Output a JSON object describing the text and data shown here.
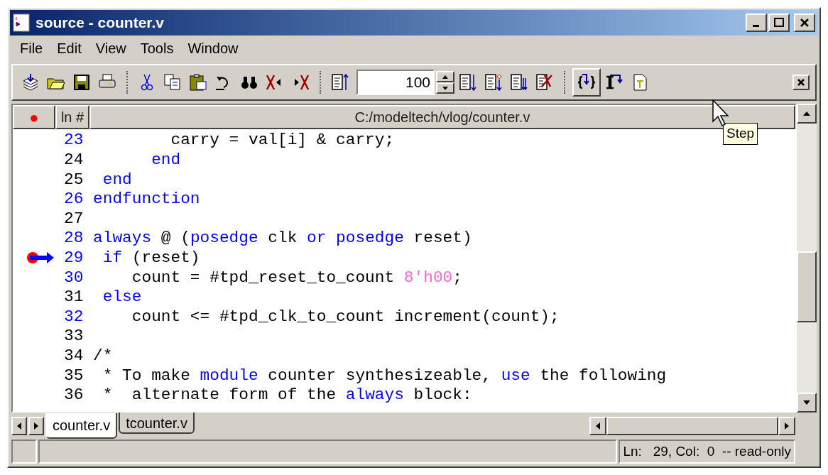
{
  "window": {
    "title": "source - counter.v"
  },
  "menu": [
    "File",
    "Edit",
    "View",
    "Tools",
    "Window"
  ],
  "toolbar": {
    "line_field": {
      "value": "100"
    },
    "tooltip": "Step"
  },
  "source": {
    "header": {
      "breakpoint_column": "●",
      "line_column": "ln #",
      "path": "C:/modeltech/vlog/counter.v"
    },
    "lines": [
      {
        "number": "23",
        "executable": true,
        "current": false,
        "tokens": [
          {
            "kind": "plain",
            "text": "        carry = val[i] & carry;"
          }
        ]
      },
      {
        "number": "24",
        "executable": false,
        "current": false,
        "tokens": [
          {
            "kind": "keyword",
            "text": "      end"
          }
        ]
      },
      {
        "number": "25",
        "executable": false,
        "current": false,
        "tokens": [
          {
            "kind": "keyword",
            "text": " end"
          }
        ]
      },
      {
        "number": "26",
        "executable": true,
        "current": false,
        "tokens": [
          {
            "kind": "keyword",
            "text": "endfunction"
          }
        ]
      },
      {
        "number": "27",
        "executable": false,
        "current": false
      },
      {
        "number": "28",
        "executable": true,
        "current": false,
        "tokens": [
          {
            "kind": "keyword",
            "text": "always"
          },
          {
            "kind": "plain",
            "text": " @ ("
          },
          {
            "kind": "keyword",
            "text": "posedge"
          },
          {
            "kind": "plain",
            "text": " clk "
          },
          {
            "kind": "keyword",
            "text": "or posedge"
          },
          {
            "kind": "plain",
            "text": " reset)"
          }
        ]
      },
      {
        "number": "29",
        "executable": true,
        "current": true,
        "tokens": [
          {
            "kind": "keyword",
            "text": " if"
          },
          {
            "kind": "plain",
            "text": " (reset)"
          }
        ]
      },
      {
        "number": "30",
        "executable": true,
        "current": false,
        "tokens": [
          {
            "kind": "plain",
            "text": "    count = #tpd_reset_to_count "
          },
          {
            "kind": "number",
            "text": "8'h00"
          },
          {
            "kind": "plain",
            "text": ";"
          }
        ]
      },
      {
        "number": "31",
        "executable": false,
        "current": false,
        "tokens": [
          {
            "kind": "keyword",
            "text": " else"
          }
        ]
      },
      {
        "number": "32",
        "executable": true,
        "current": false,
        "tokens": [
          {
            "kind": "plain",
            "text": "    count <= #tpd_clk_to_count increment(count);"
          }
        ]
      },
      {
        "number": "33",
        "executable": false,
        "current": false
      },
      {
        "number": "34",
        "executable": false,
        "current": false,
        "tokens": [
          {
            "kind": "plain",
            "text": "/*"
          }
        ]
      },
      {
        "number": "35",
        "executable": false,
        "current": false,
        "tokens": [
          {
            "kind": "plain",
            "text": " * To make "
          },
          {
            "kind": "keyword",
            "text": "module"
          },
          {
            "kind": "plain",
            "text": " counter synthesizeable, "
          },
          {
            "kind": "keyword",
            "text": "use"
          },
          {
            "kind": "plain",
            "text": " the following"
          }
        ]
      },
      {
        "number": "36",
        "executable": false,
        "current": false,
        "tokens": [
          {
            "kind": "plain",
            "text": " *  alternate form of the "
          },
          {
            "kind": "keyword",
            "text": "always"
          },
          {
            "kind": "plain",
            "text": " block:"
          }
        ]
      }
    ]
  },
  "tabs": [
    {
      "label": "counter.v",
      "selected": true
    },
    {
      "label": "tcounter.v",
      "selected": false
    }
  ],
  "status_bar": {
    "position": "Ln:   29, Col:  0  -- read-only"
  }
}
